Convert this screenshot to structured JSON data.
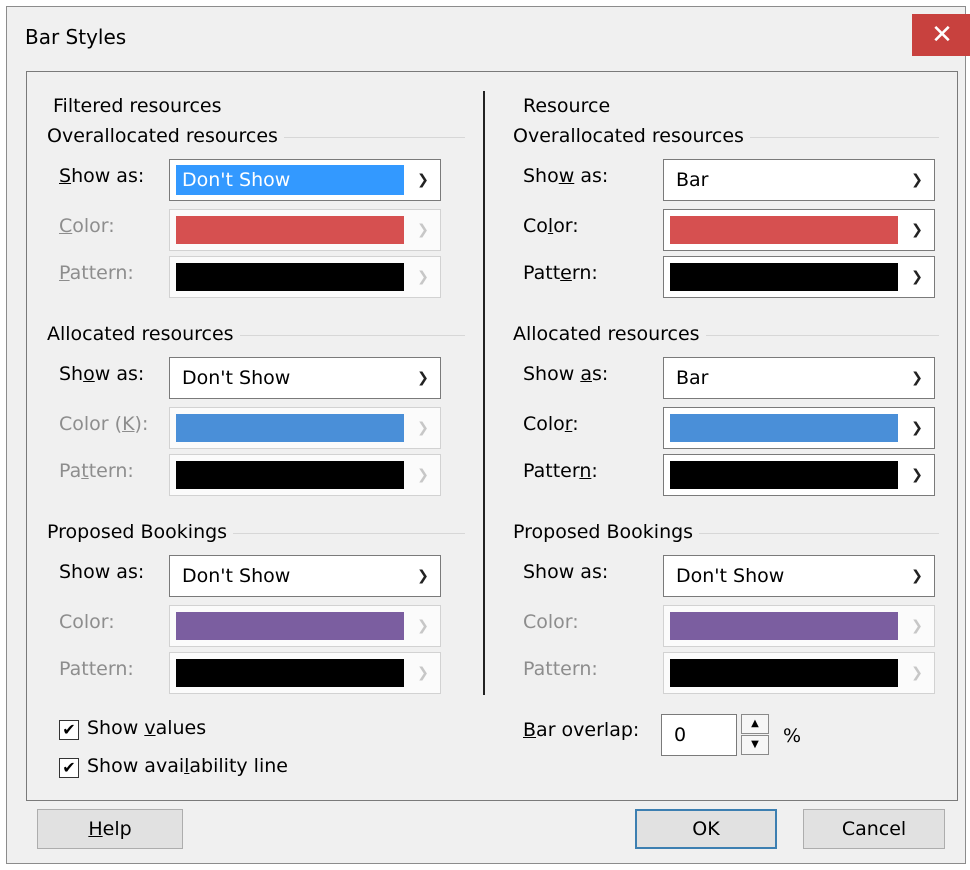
{
  "window": {
    "title": "Bar Styles",
    "close_glyph": "✕"
  },
  "left": {
    "header": "Filtered resources",
    "groups": [
      {
        "title": "Overallocated resources",
        "show_as": {
          "label": "Show as:",
          "value": "Don't Show"
        },
        "color": {
          "label": "Color:",
          "swatch": "#d65050"
        },
        "pattern": {
          "label": "Pattern:",
          "swatch": "#000000"
        }
      },
      {
        "title": "Allocated resources",
        "show_as": {
          "label": "Show as:",
          "value": "Don't Show"
        },
        "color": {
          "label": "Color (K):",
          "swatch": "#4a8fd8"
        },
        "pattern": {
          "label": "Pattern:",
          "swatch": "#000000"
        }
      },
      {
        "title": "Proposed Bookings",
        "show_as": {
          "label": "Show as:",
          "value": "Don't Show"
        },
        "color": {
          "label": "Color:",
          "swatch": "#7b5ea0"
        },
        "pattern": {
          "label": "Pattern:",
          "swatch": "#000000"
        }
      }
    ]
  },
  "right": {
    "header": "Resource",
    "groups": [
      {
        "title": "Overallocated resources",
        "show_as": {
          "label": "Show as:",
          "value": "Bar"
        },
        "color": {
          "label": "Color:",
          "swatch": "#d65050"
        },
        "pattern": {
          "label": "Pattern:",
          "swatch": "#000000"
        }
      },
      {
        "title": "Allocated resources",
        "show_as": {
          "label": "Show as:",
          "value": "Bar"
        },
        "color": {
          "label": "Color:",
          "swatch": "#4a8fd8"
        },
        "pattern": {
          "label": "Pattern:",
          "swatch": "#000000"
        }
      },
      {
        "title": "Proposed Bookings",
        "show_as": {
          "label": "Show as:",
          "value": "Don't Show"
        },
        "color": {
          "label": "Color:",
          "swatch": "#7b5ea0"
        },
        "pattern": {
          "label": "Pattern:",
          "swatch": "#000000"
        }
      }
    ]
  },
  "options": {
    "show_values": "Show values",
    "show_availability": "Show availability line",
    "bar_overlap_label": "Bar overlap:",
    "bar_overlap_value": "0",
    "bar_overlap_unit": "%"
  },
  "buttons": {
    "help": "Help",
    "ok": "OK",
    "cancel": "Cancel"
  },
  "icons": {
    "dropdown": "chevron-down-icon",
    "check": "check-icon",
    "spin_up": "triangle-up-icon",
    "spin_down": "triangle-down-icon"
  }
}
